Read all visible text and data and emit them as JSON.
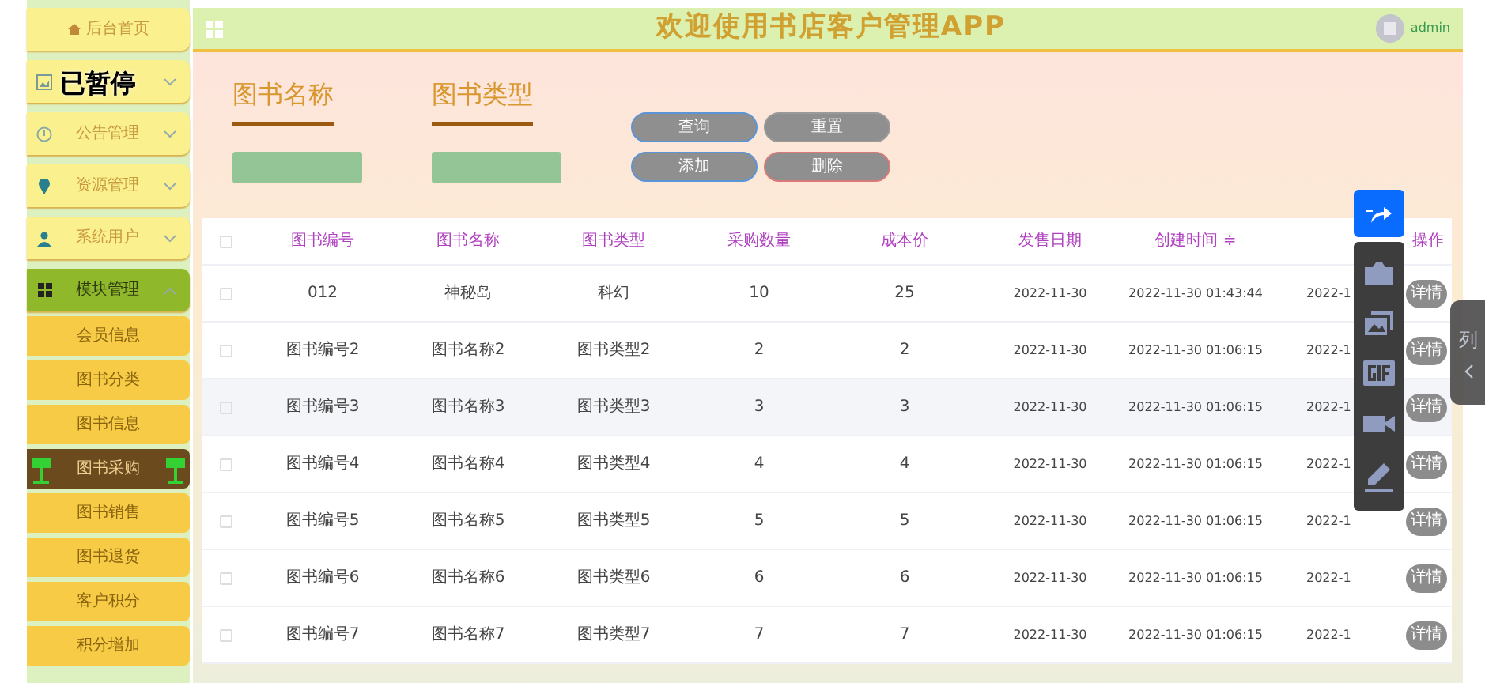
{
  "sidebar": {
    "home": "后台首页",
    "paused_label": "已暂停",
    "items": [
      {
        "expanded": false
      },
      {
        "label": "公告管理",
        "expanded": false
      },
      {
        "label": "资源管理",
        "expanded": false
      },
      {
        "label": "系统用户",
        "expanded": false
      },
      {
        "label": "模块管理",
        "expanded": true,
        "children": [
          {
            "label": "会员信息",
            "selected": false
          },
          {
            "label": "图书分类",
            "selected": false
          },
          {
            "label": "图书信息",
            "selected": false
          },
          {
            "label": "图书采购",
            "selected": true
          },
          {
            "label": "图书销售",
            "selected": false
          },
          {
            "label": "图书退货",
            "selected": false
          },
          {
            "label": "客户积分",
            "selected": false
          },
          {
            "label": "积分增加",
            "selected": false
          }
        ]
      }
    ]
  },
  "header": {
    "title": "欢迎使用书店客户管理APP",
    "user": "admin"
  },
  "search": {
    "fields": [
      {
        "label": "图书名称"
      },
      {
        "label": "图书类型"
      }
    ],
    "buttons": [
      {
        "label": "查询",
        "kind": "normal"
      },
      {
        "label": "重置",
        "kind": "plain"
      },
      {
        "label": "添加",
        "kind": "normal"
      },
      {
        "label": "删除",
        "kind": "danger"
      }
    ]
  },
  "table": {
    "header_checked": false,
    "columns": [
      "图书编号",
      "图书名称",
      "图书类型",
      "采购数量",
      "成本价",
      "发售日期",
      "创建时间 ≑",
      null,
      "操作"
    ],
    "rows": [
      {
        "checked": false,
        "hovered": false,
        "cells": [
          "012",
          "神秘岛",
          "科幻",
          "10",
          "25",
          "2022-11-30",
          "2022-11-30 01:43:44",
          "2022-1"
        ],
        "action": "详情"
      },
      {
        "checked": false,
        "hovered": false,
        "cells": [
          "图书编号2",
          "图书名称2",
          "图书类型2",
          "2",
          "2",
          "2022-11-30",
          "2022-11-30 01:06:15",
          "2022-1"
        ],
        "action": "详情"
      },
      {
        "checked": false,
        "hovered": true,
        "cells": [
          "图书编号3",
          "图书名称3",
          "图书类型3",
          "3",
          "3",
          "2022-11-30",
          "2022-11-30 01:06:15",
          "2022-1"
        ],
        "action": "详情"
      },
      {
        "checked": false,
        "hovered": false,
        "cells": [
          "图书编号4",
          "图书名称4",
          "图书类型4",
          "4",
          "4",
          "2022-11-30",
          "2022-11-30 01:06:15",
          "2022-1"
        ],
        "action": "详情"
      },
      {
        "checked": false,
        "hovered": false,
        "cells": [
          "图书编号5",
          "图书名称5",
          "图书类型5",
          "5",
          "5",
          "2022-11-30",
          "2022-11-30 01:06:15",
          "2022-1"
        ],
        "action": "详情"
      },
      {
        "checked": false,
        "hovered": false,
        "cells": [
          "图书编号6",
          "图书名称6",
          "图书类型6",
          "6",
          "6",
          "2022-11-30",
          "2022-11-30 01:06:15",
          "2022-1"
        ],
        "action": "详情"
      },
      {
        "checked": false,
        "hovered": false,
        "cells": [
          "图书编号7",
          "图书名称7",
          "图书类型7",
          "7",
          "7",
          "2022-11-30",
          "2022-11-30 01:06:15",
          "2022-1"
        ],
        "action": "详情"
      }
    ]
  },
  "side_panel": {
    "label": "列"
  }
}
